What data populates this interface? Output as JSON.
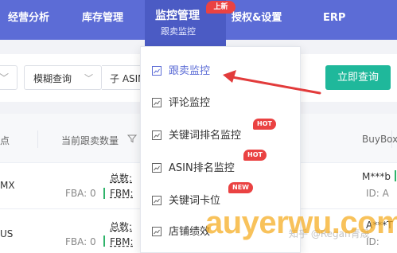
{
  "nav": {
    "items": [
      {
        "label": "经营分析"
      },
      {
        "label": "库存管理"
      },
      {
        "label": "监控管理",
        "sub": "跟卖监控",
        "badge": "上新"
      },
      {
        "label": "授权&设置"
      },
      {
        "label": "ERP"
      }
    ]
  },
  "search": {
    "mode_value": "模糊查询",
    "type_value": "子 ASIN",
    "query_button": "立即查询"
  },
  "table": {
    "headers": {
      "col0": "点",
      "col1": "当前跟卖数量",
      "col3": "BuyBox"
    },
    "rows": [
      {
        "site": "MX",
        "fba": "FBA: 0",
        "fbm": "FBM:",
        "total": "总数:",
        "buybox_seller": "M***b",
        "buybox_id": "ID: A"
      },
      {
        "site": "US",
        "fba": "FBA: 0",
        "fbm": "FBM:",
        "total": "总数:",
        "buybox_seller": "A***T",
        "buybox_id": "ID:"
      }
    ]
  },
  "dropdown": {
    "items": [
      {
        "label": "跟卖监控",
        "selected": true
      },
      {
        "label": "评论监控"
      },
      {
        "label": "关键词排名监控",
        "badge": "HOT"
      },
      {
        "label": "ASIN排名监控",
        "badge": "HOT"
      },
      {
        "label": "关键词卡位",
        "badge": "NEW"
      },
      {
        "label": "店铺绩效"
      }
    ]
  },
  "watermark": {
    "zhihu": "知乎 @Regan青晟",
    "site": "auyerwu.com"
  },
  "colors": {
    "nav_bg": "#5c6cd6",
    "accent_green": "#1fb89b",
    "badge_red": "#ea4242",
    "arrow_red": "#e23b3b"
  }
}
